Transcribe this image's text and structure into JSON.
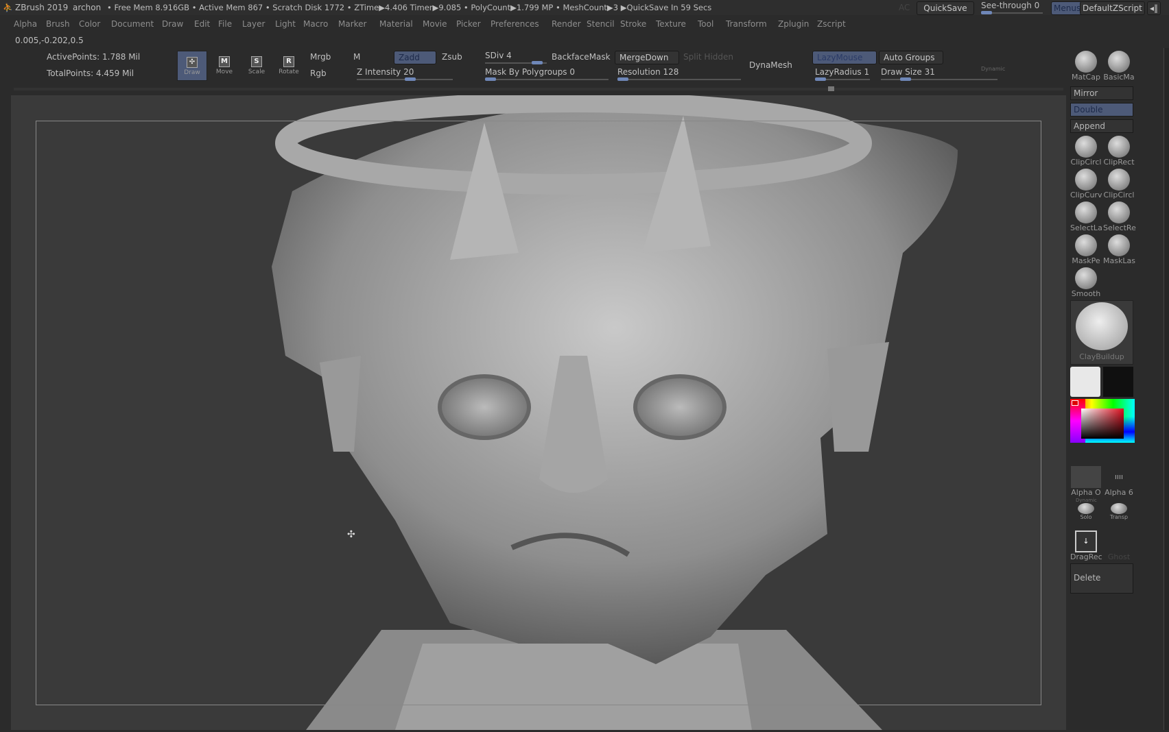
{
  "titlebar": {
    "app": "ZBrush 2019",
    "project": "archon",
    "stats": "• Free Mem 8.916GB • Active Mem 867 • Scratch Disk 1772 • ZTime▶4.406 Timer▶9.085 • PolyCount▶1.799 MP • MeshCount▶3 ▶QuickSave In 59 Secs",
    "ac": "AC",
    "quicksave": "QuickSave",
    "seethrough": "See-through  0",
    "seethrough_value": 0,
    "menus": "Menus",
    "script": "DefaultZScript"
  },
  "menu": [
    "Alpha",
    "Brush",
    "Color",
    "Document",
    "Draw",
    "Edit",
    "File",
    "Layer",
    "Light",
    "Macro",
    "Marker",
    "Material",
    "Movie",
    "Picker",
    "Preferences",
    "Render",
    "Stencil",
    "Stroke",
    "Texture",
    "Tool",
    "Transform",
    "Zplugin",
    "Zscript"
  ],
  "coords": "0.005,-0.202,0.5",
  "toolbar": {
    "active_points": "ActivePoints: 1.788 Mil",
    "total_points": "TotalPoints: 4.459 Mil",
    "tools": [
      {
        "key": "",
        "label": "Draw"
      },
      {
        "key": "M",
        "label": "Move"
      },
      {
        "key": "S",
        "label": "Scale"
      },
      {
        "key": "R",
        "label": "Rotate"
      }
    ],
    "mrgb": "Mrgb",
    "rgb": "Rgb",
    "m": "M",
    "zadd": "Zadd",
    "zsub": "Zsub",
    "z_intensity": "Z Intensity 20",
    "sdiv": "SDiv 4",
    "mask_by_polygroups": "Mask By Polygroups 0",
    "backface_mask": "BackfaceMask",
    "merge_down": "MergeDown",
    "split_hidden": "Split Hidden",
    "resolution": "Resolution 128",
    "dynamesh": "DynaMesh",
    "lazymouse": "LazyMouse",
    "lazyradius": "LazyRadius 1",
    "auto_groups": "Auto Groups",
    "draw_size": "Draw Size 31",
    "dynamic": "Dynamic"
  },
  "right_panel": {
    "matcap": "MatCap",
    "basic": "BasicMa",
    "mirror": "Mirror",
    "double": "Double",
    "append": "Append",
    "brushes": [
      "ClipCircl",
      "ClipRect",
      "ClipCurv",
      "ClipCircl",
      "SelectLa",
      "SelectRe",
      "MaskPe",
      "MaskLas",
      "Smooth"
    ],
    "current_brush": "ClayBuildup",
    "alpha_off": "Alpha O",
    "alpha6": "Alpha 6",
    "dynamic": "Dynamic",
    "solo": "Solo",
    "transp": "Transp",
    "dragrect": "DragRec",
    "ghost": "Ghost",
    "delete": "Delete"
  },
  "colors": {
    "accent": "#4d5a78",
    "slider": "#6f87b8",
    "bg": "#2b2b2b",
    "canvas": "#3a3a3a",
    "primary_color": "#e8e8e8",
    "secondary_color": "#101010"
  }
}
